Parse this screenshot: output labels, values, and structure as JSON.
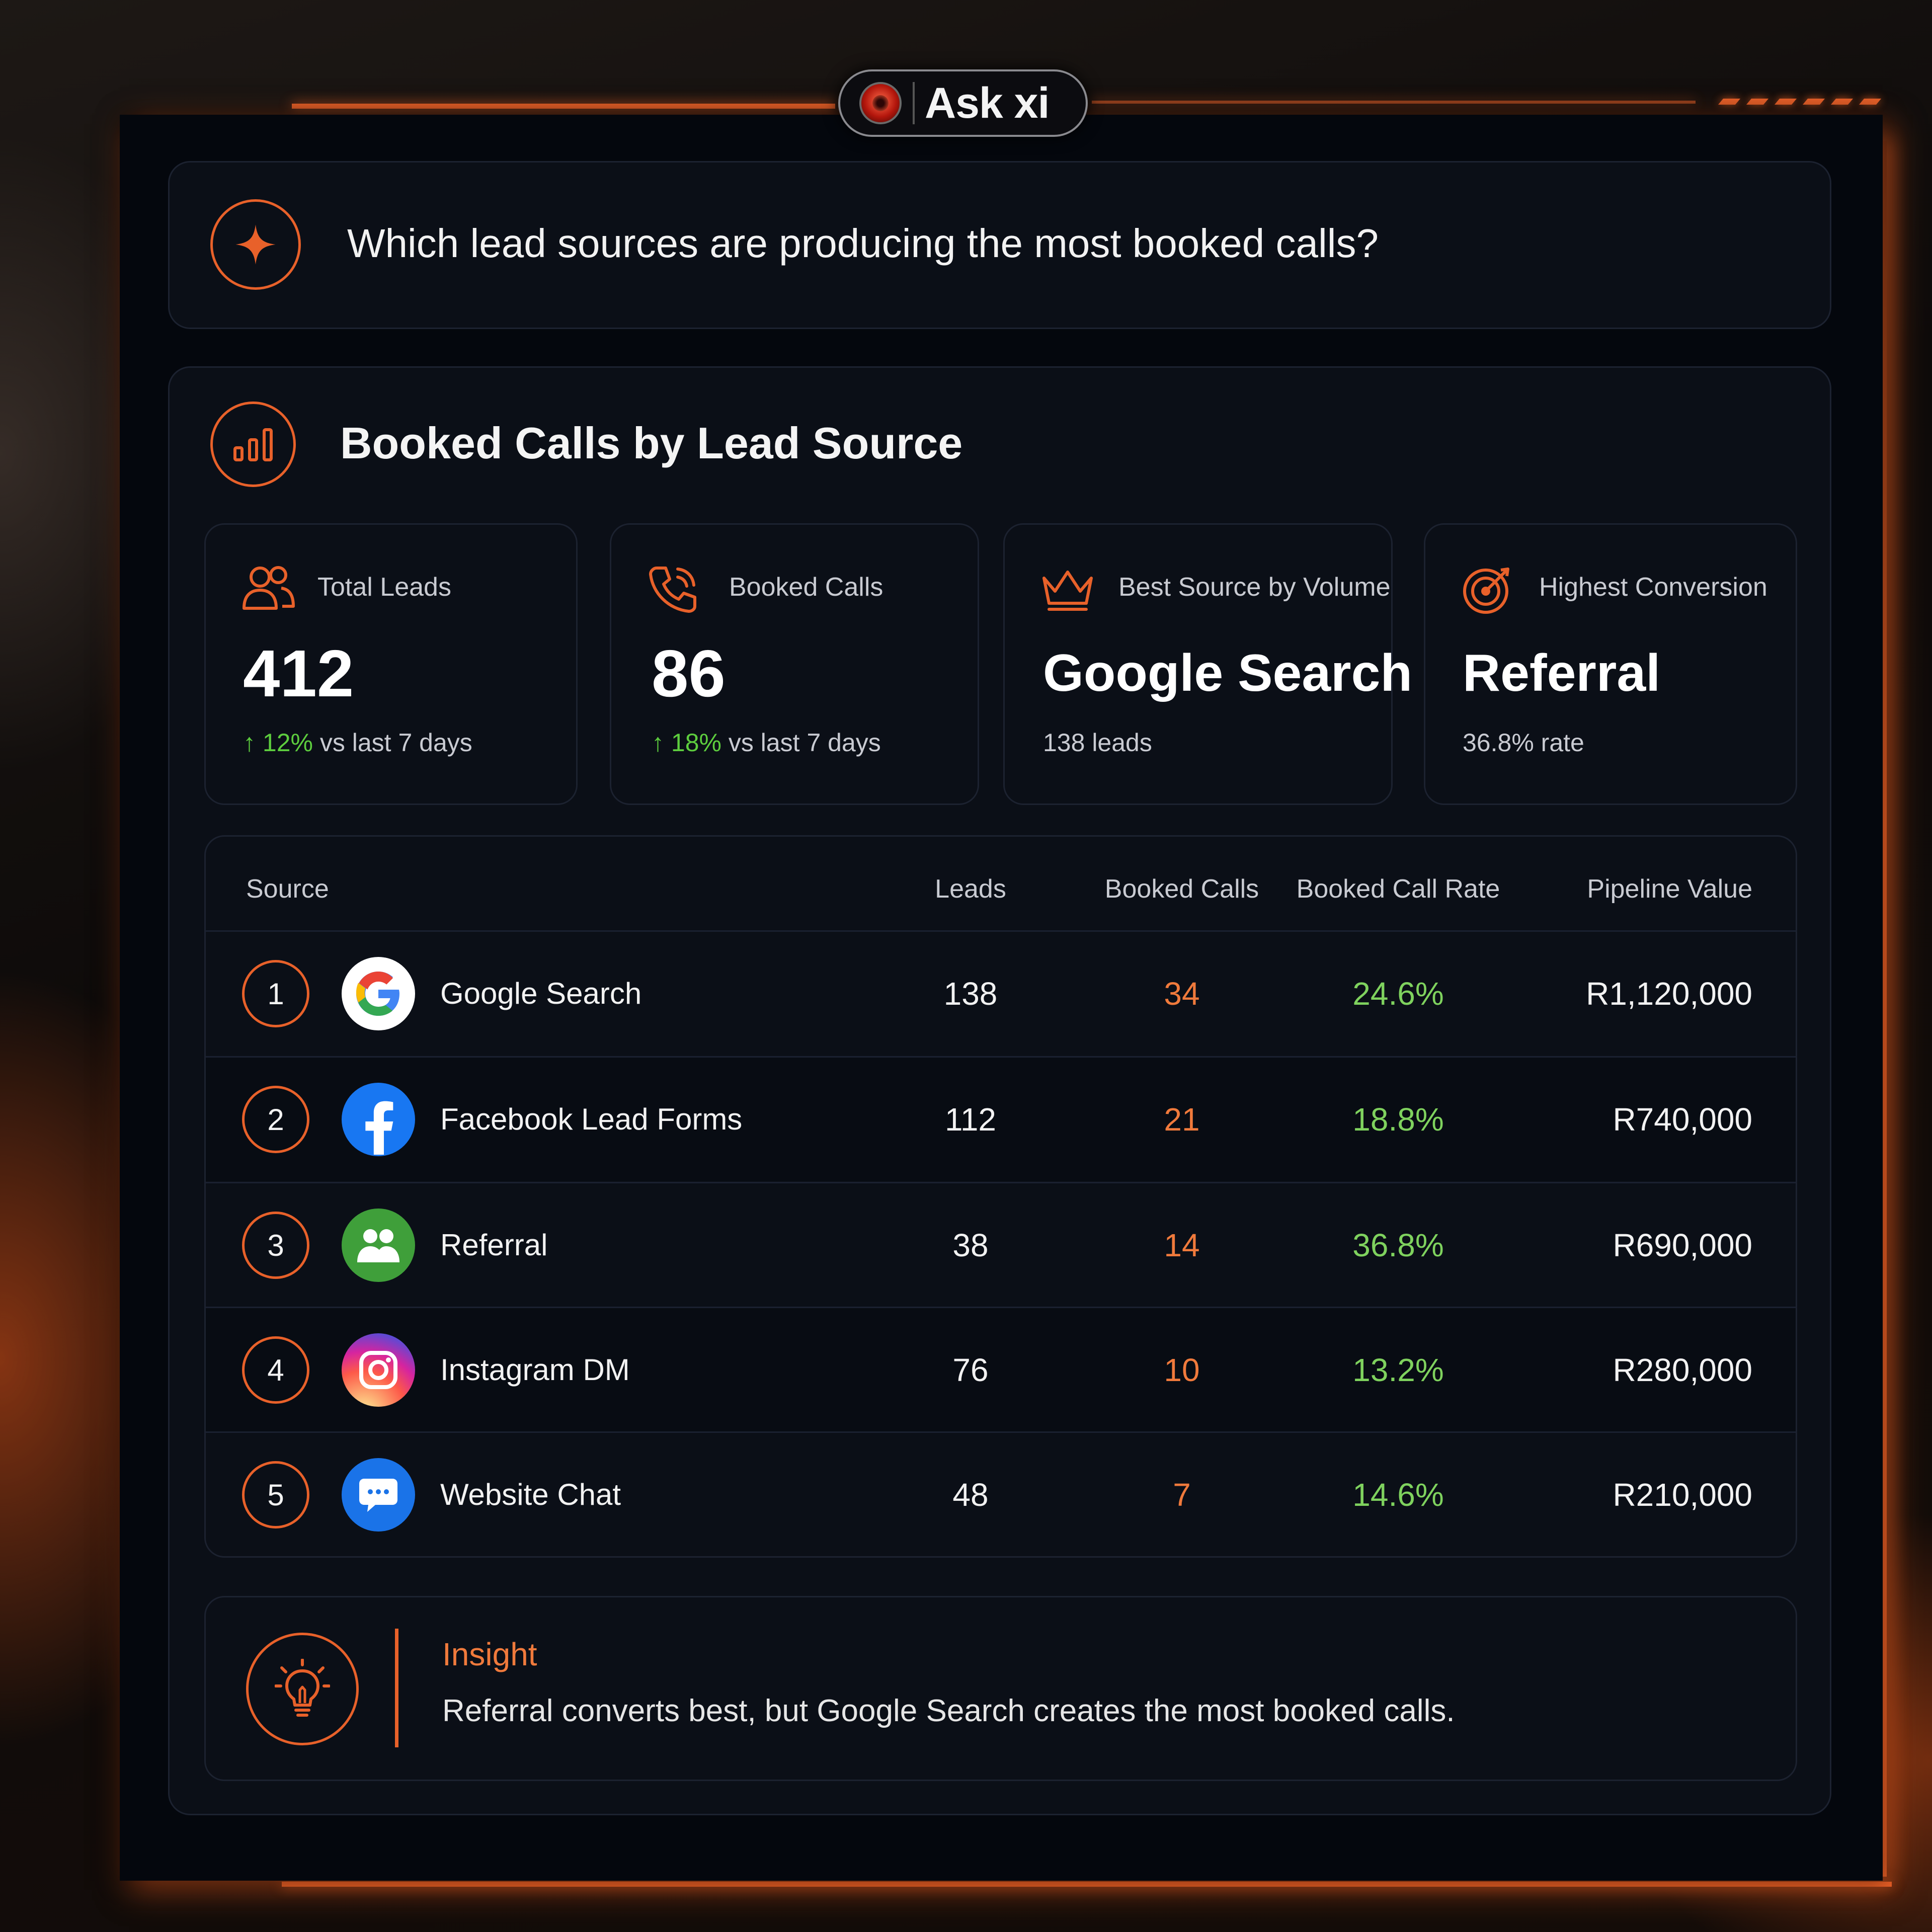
{
  "app": {
    "name": "Ask xi"
  },
  "question": {
    "text": "Which lead sources are producing the most booked calls?"
  },
  "section": {
    "title": "Booked Calls by Lead Source"
  },
  "kpis": [
    {
      "label": "Total Leads",
      "value": "412",
      "delta": "12%",
      "delta_suffix": " vs last 7 days",
      "icon": "users-icon"
    },
    {
      "label": "Booked Calls",
      "value": "86",
      "delta": "18%",
      "delta_suffix": " vs last 7 days",
      "icon": "phone-icon"
    },
    {
      "label": "Best Source by Volume",
      "value": "Google Search",
      "sub": "138 leads",
      "icon": "crown-icon"
    },
    {
      "label": "Highest Conversion",
      "value": "Referral",
      "sub": "36.8% rate",
      "icon": "target-icon"
    }
  ],
  "table": {
    "headers": [
      "Source",
      "Leads",
      "Booked Calls",
      "Booked Call Rate",
      "Pipeline Value"
    ],
    "rows": [
      {
        "rank": "1",
        "source": "Google Search",
        "leads": "138",
        "booked_calls": "34",
        "rate": "24.6%",
        "pipeline": "R1,120,000",
        "icon": "google-icon"
      },
      {
        "rank": "2",
        "source": "Facebook Lead Forms",
        "leads": "112",
        "booked_calls": "21",
        "rate": "18.8%",
        "pipeline": "R740,000",
        "icon": "facebook-icon"
      },
      {
        "rank": "3",
        "source": "Referral",
        "leads": "38",
        "booked_calls": "14",
        "rate": "36.8%",
        "pipeline": "R690,000",
        "icon": "referral-icon"
      },
      {
        "rank": "4",
        "source": "Instagram DM",
        "leads": "76",
        "booked_calls": "10",
        "rate": "13.2%",
        "pipeline": "R280,000",
        "icon": "instagram-icon"
      },
      {
        "rank": "5",
        "source": "Website Chat",
        "leads": "48",
        "booked_calls": "7",
        "rate": "14.6%",
        "pipeline": "R210,000",
        "icon": "chat-icon"
      }
    ]
  },
  "insight": {
    "title": "Insight",
    "text": "Referral converts best, but Google Search creates the most booked calls."
  },
  "colors": {
    "accent": "#e8612a",
    "positive": "#5dcd3e",
    "calls": "#f07a3c",
    "rate": "#7fd25e",
    "background": "#04070d"
  }
}
